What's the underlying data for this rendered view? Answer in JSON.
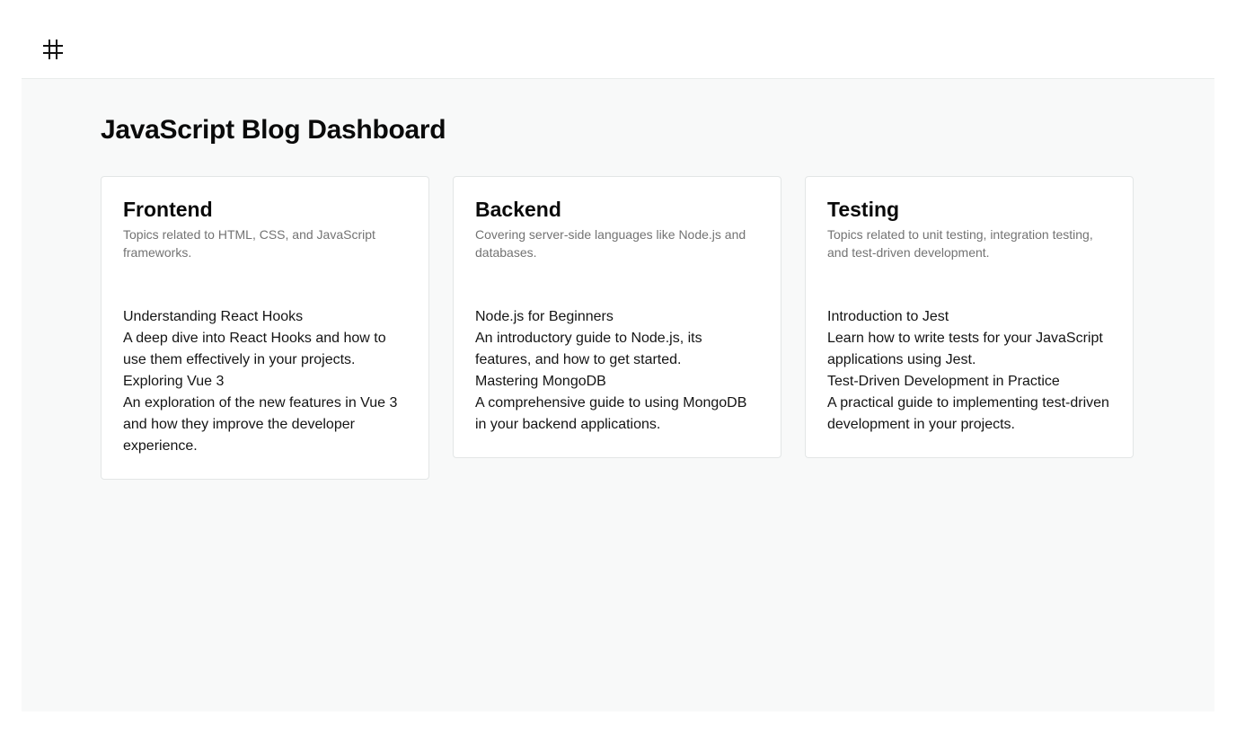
{
  "header": {
    "logo_icon": "hash-icon"
  },
  "main": {
    "title": "JavaScript Blog Dashboard",
    "categories": [
      {
        "title": "Frontend",
        "description": "Topics related to HTML, CSS, and JavaScript frameworks.",
        "posts": [
          {
            "title": "Understanding React Hooks",
            "summary": "A deep dive into React Hooks and how to use them effectively in your projects."
          },
          {
            "title": "Exploring Vue 3",
            "summary": "An exploration of the new features in Vue 3 and how they improve the developer experience."
          }
        ]
      },
      {
        "title": "Backend",
        "description": "Covering server-side languages like Node.js and databases.",
        "posts": [
          {
            "title": "Node.js for Beginners",
            "summary": "An introductory guide to Node.js, its features, and how to get started."
          },
          {
            "title": "Mastering MongoDB",
            "summary": "A comprehensive guide to using MongoDB in your backend applications."
          }
        ]
      },
      {
        "title": "Testing",
        "description": "Topics related to unit testing, integration testing, and test-driven development.",
        "posts": [
          {
            "title": "Introduction to Jest",
            "summary": "Learn how to write tests for your JavaScript applications using Jest."
          },
          {
            "title": "Test-Driven Development in Practice",
            "summary": "A practical guide to implementing test-driven development in your projects."
          }
        ]
      }
    ]
  }
}
